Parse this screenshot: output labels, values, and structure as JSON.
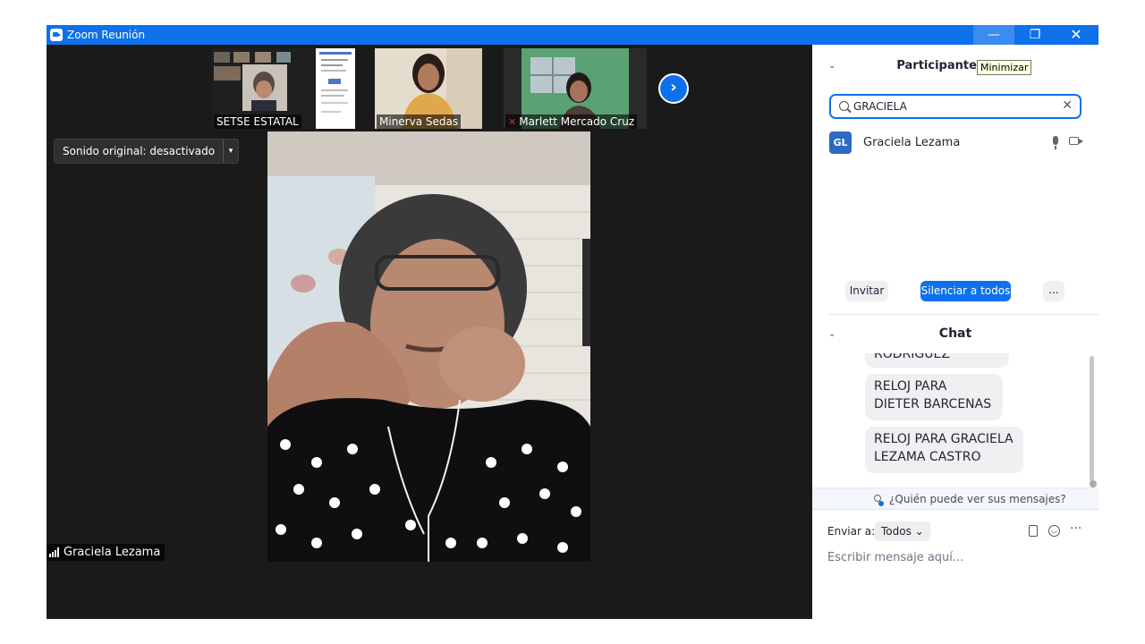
{
  "window": {
    "title": "Zoom Reunión",
    "minimize_glyph": "—",
    "maximize_glyph": "❐",
    "close_glyph": "✕"
  },
  "gallery": {
    "thumbnails": [
      {
        "name": "SETSE ESTATAL",
        "muted": false
      },
      {
        "name": "Minerva Sedas",
        "muted": false
      },
      {
        "name": "Marlett Mercado Cruz",
        "muted": true
      }
    ],
    "next_glyph": "›"
  },
  "audio": {
    "original_sound": "Sonido original: desactivado",
    "dropdown_glyph": "▾"
  },
  "main_video": {
    "speaker_name": "Graciela Lezama"
  },
  "participants_panel": {
    "collapse_glyph": "⌄",
    "title": "Participantes",
    "tooltip": "Minimizar",
    "search_value": "GRACIELA",
    "clear_glyph": "✕",
    "list": [
      {
        "initials": "GL",
        "name": "Graciela Lezama"
      }
    ],
    "buttons": {
      "invite": "Invitar",
      "mute_all": "Silenciar a todos",
      "more": "..."
    }
  },
  "chat": {
    "collapse_glyph": "⌄",
    "title": "Chat",
    "messages": [
      "RODRIGUEZ",
      "RELOJ PARA DIETER BARCENAS",
      "RELOJ PARA  GRACIELA LEZAMA CASTRO"
    ],
    "privacy_text": "¿Quién puede ver sus mensajes?",
    "send_to_label": "Enviar a:",
    "send_to_value": "Todos",
    "send_to_glyph": "⌄",
    "more_glyph": "···",
    "input_placeholder": "Escribir mensaje aquí..."
  },
  "colors": {
    "zoom_blue": "#0e71eb",
    "video_background": "#1a1a1a",
    "bubble": "#f0f0f3"
  }
}
